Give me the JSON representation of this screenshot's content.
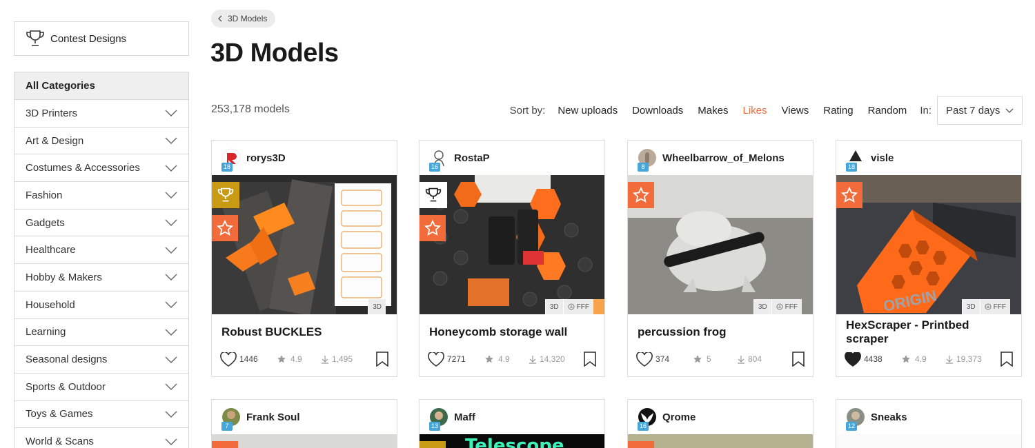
{
  "sidebar": {
    "contest_label": "Contest Designs",
    "all_categories": "All Categories",
    "categories": [
      "3D Printers",
      "Art & Design",
      "Costumes & Accessories",
      "Fashion",
      "Gadgets",
      "Healthcare",
      "Hobby & Makers",
      "Household",
      "Learning",
      "Seasonal designs",
      "Sports & Outdoor",
      "Toys & Games",
      "World & Scans"
    ]
  },
  "breadcrumb": "3D Models",
  "title": "3D Models",
  "model_count": "253,178 models",
  "sort": {
    "label": "Sort by:",
    "options": [
      "New uploads",
      "Downloads",
      "Makes",
      "Likes",
      "Views",
      "Rating",
      "Random"
    ],
    "active": "Likes",
    "in_label": "In:",
    "period": "Past 7 days"
  },
  "accent_color": "#f26b3a",
  "cards": [
    {
      "user": "rorys3D",
      "level": "18",
      "title": "Robust BUCKLES",
      "likes": "1446",
      "rating": "4.9",
      "downloads": "1,495",
      "tags": [
        "3D"
      ],
      "contest": true,
      "liked": false
    },
    {
      "user": "RostaP",
      "level": "16",
      "title": "Honeycomb storage wall",
      "likes": "7271",
      "rating": "4.9",
      "downloads": "14,320",
      "tags": [
        "3D",
        "FFF"
      ],
      "contest": true,
      "liked": false
    },
    {
      "user": "Wheelbarrow_of_Melons",
      "level": "8",
      "title": "percussion frog",
      "likes": "374",
      "rating": "5",
      "downloads": "804",
      "tags": [
        "3D",
        "FFF"
      ],
      "contest": false,
      "liked": false
    },
    {
      "user": "visle",
      "level": "18",
      "title": "HexScraper - Printbed scraper",
      "likes": "4438",
      "rating": "4.9",
      "downloads": "19,373",
      "tags": [
        "3D",
        "FFF"
      ],
      "contest": false,
      "liked": true
    }
  ],
  "cards_row2": [
    {
      "user": "Frank Soul",
      "level": "7"
    },
    {
      "user": "Maff",
      "level": "13",
      "thumb_text": "Telescope"
    },
    {
      "user": "Qrome",
      "level": "16"
    },
    {
      "user": "Sneaks",
      "level": "12"
    }
  ]
}
